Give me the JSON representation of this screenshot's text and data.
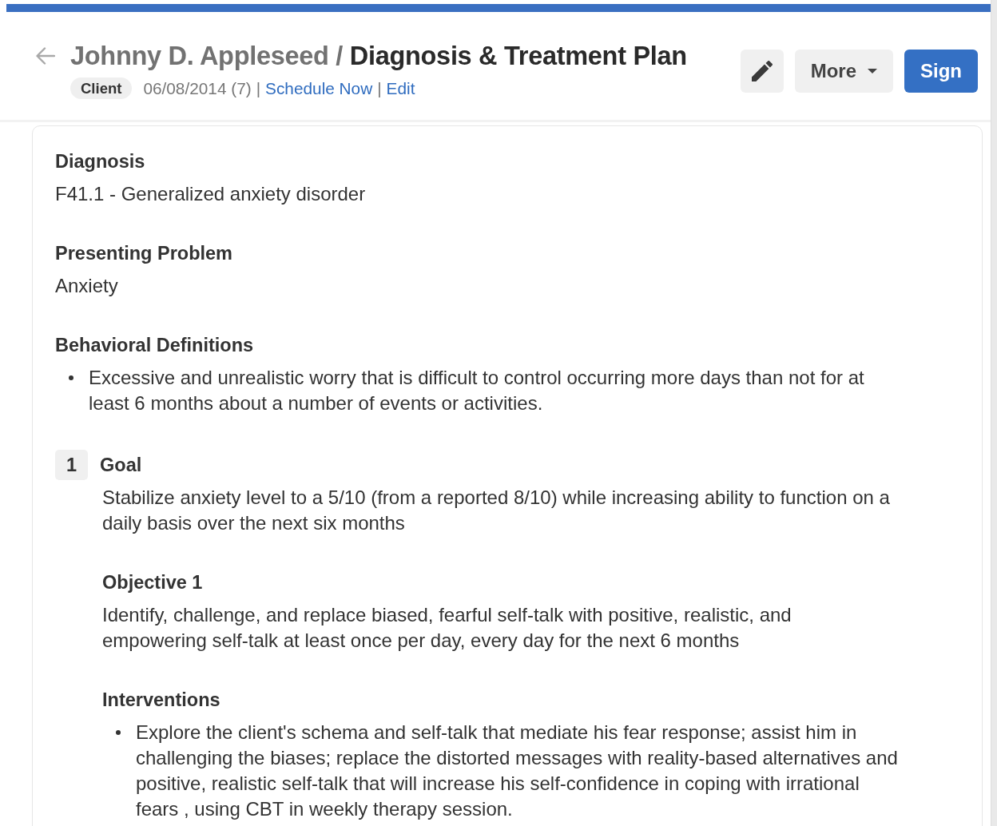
{
  "header": {
    "client_name": "Johnny D. Appleseed",
    "title_separator": "/",
    "page_title": "Diagnosis & Treatment Plan",
    "badge": "Client",
    "meta": [
      {
        "kind": "text",
        "text": "06/08/2014 (7)"
      },
      {
        "kind": "separator",
        "text": "|"
      },
      {
        "kind": "link",
        "text": "Schedule Now"
      },
      {
        "kind": "separator",
        "text": "|"
      },
      {
        "kind": "link",
        "text": "Edit"
      }
    ]
  },
  "actions": [
    {
      "kind": "icon"
    },
    {
      "kind": "menu",
      "label": "More"
    },
    {
      "kind": "primary",
      "label": "Sign"
    }
  ],
  "sections": [
    {
      "heading": "Diagnosis",
      "kind": "text",
      "text": "F41.1 - Generalized anxiety disorder"
    },
    {
      "heading": "Presenting Problem",
      "kind": "text",
      "text": "Anxiety"
    },
    {
      "heading": "Behavioral Definitions",
      "kind": "list",
      "items": [
        "Excessive and unrealistic worry that is difficult to control occurring more days than not for at least 6 months about a number of events or activities."
      ]
    }
  ],
  "goals": [
    {
      "number": "1",
      "label": "Goal",
      "text": "Stabilize anxiety level to a 5/10 (from a reported 8/10) while increasing ability to function on a daily basis over the next six months",
      "details": [
        {
          "heading": "Objective 1",
          "kind": "text",
          "text": "Identify, challenge, and replace biased, fearful self-talk with positive, realistic, and empowering self-talk at least once per day, every day for the next 6 months"
        },
        {
          "heading": "Interventions",
          "kind": "list",
          "items": [
            "Explore the client's schema and self-talk that mediate his fear response; assist him in challenging the biases; replace the distorted messages with reality-based alternatives and positive, realistic self-talk that will increase his self-confidence in coping with irrational fears , using CBT in weekly therapy session."
          ]
        }
      ]
    }
  ]
}
